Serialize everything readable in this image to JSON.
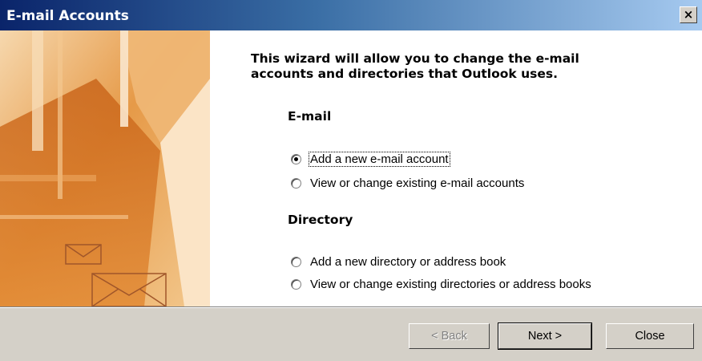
{
  "window": {
    "title": "E-mail Accounts",
    "close_glyph": "×"
  },
  "intro": {
    "line1": "This wizard will allow you to change the e-mail",
    "line2": "accounts and directories that Outlook uses."
  },
  "email_section": {
    "heading": "E-mail",
    "options": [
      {
        "label": "Add a new e-mail account",
        "selected": true
      },
      {
        "label": "View or change existing e-mail accounts",
        "selected": false
      }
    ]
  },
  "directory_section": {
    "heading": "Directory",
    "options": [
      {
        "label": "Add a new directory or address book",
        "selected": false
      },
      {
        "label": "View or change existing directories or address books",
        "selected": false
      }
    ]
  },
  "buttons": {
    "back": "< Back",
    "next": "Next >",
    "close": "Close"
  },
  "colors": {
    "title_bar_start": "#0a246a",
    "title_bar_end": "#a6caf0",
    "dialog_face": "#d4d0c8",
    "art_orange": "#e07820"
  }
}
